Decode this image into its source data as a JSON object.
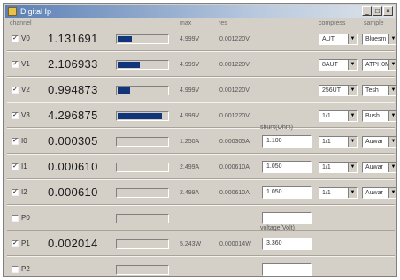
{
  "window": {
    "title": "Digital Ip"
  },
  "headers": {
    "channel": "channel",
    "max": "max",
    "res": "res",
    "compress": "compress",
    "sample": "sample"
  },
  "rows": [
    {
      "name": "V0",
      "checked": true,
      "value": "1.131691",
      "level": 0.27,
      "max": "4.999V",
      "res": "0.001220V",
      "compress": "AUT",
      "sample": "Bluesm"
    },
    {
      "name": "V1",
      "checked": true,
      "value": "2.106933",
      "level": 0.43,
      "max": "4.999V",
      "res": "0.001220V",
      "compress": "8AUT",
      "sample": "ATPH0M"
    },
    {
      "name": "V2",
      "checked": true,
      "value": "0.994873",
      "level": 0.24,
      "max": "4.999V",
      "res": "0.001220V",
      "compress": "256UT",
      "sample": "Tesh"
    },
    {
      "name": "V3",
      "checked": true,
      "value": "4.296875",
      "level": 0.86,
      "max": "4.999V",
      "res": "0.001220V",
      "compress": "1/1",
      "sample": "Bush"
    },
    {
      "name": "I0",
      "checked": true,
      "value": "0.000305",
      "level": 0,
      "max": "1.250A",
      "res": "0.000305A",
      "shunt": "1.100",
      "compress": "1/1",
      "sample": "Auwar"
    },
    {
      "name": "I1",
      "checked": true,
      "value": "0.000610",
      "level": 0,
      "max": "2.499A",
      "res": "0.000610A",
      "shunt": "1.050",
      "compress": "1/1",
      "sample": "Auwar"
    },
    {
      "name": "I2",
      "checked": true,
      "value": "0.000610",
      "level": 0,
      "max": "2.499A",
      "res": "0.000610A",
      "shunt": "1.050",
      "compress": "1/1",
      "sample": "Auwar"
    },
    {
      "name": "P0",
      "checked": false,
      "value": "",
      "level": 0,
      "max": "",
      "res": "",
      "shunt": ""
    },
    {
      "name": "P1",
      "checked": true,
      "value": "0.002014",
      "level": 0,
      "max": "5.243W",
      "res": "0.000014W",
      "shunt": "3.360"
    },
    {
      "name": "P2",
      "checked": false,
      "value": "",
      "level": 0,
      "max": "",
      "res": "",
      "shunt": ""
    }
  ],
  "labels": {
    "shunt_ohm": "shunt(Ohm)",
    "voltage_volt": "voltage(Volt)"
  }
}
